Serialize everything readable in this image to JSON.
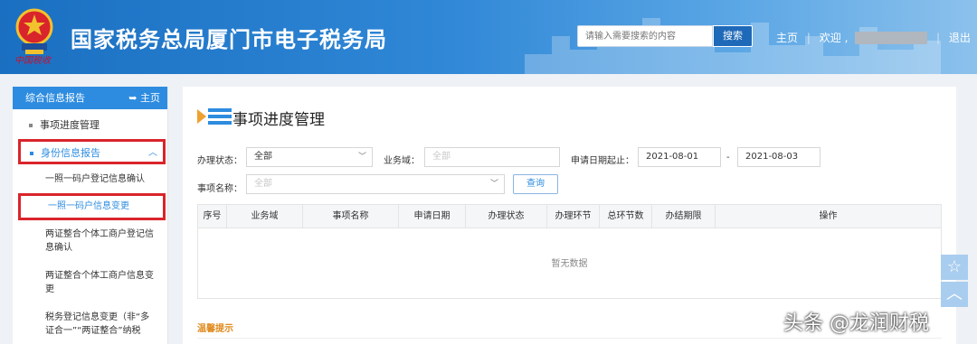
{
  "header": {
    "title": "国家税务总局厦门市电子税务局",
    "emblem_signature": "中国税收",
    "search_placeholder": "请输入需要搜索的内容",
    "search_button": "搜索",
    "home_link": "主页",
    "welcome": "欢迎",
    "logout": "退出",
    "separator": "|"
  },
  "sidebar": {
    "header": "综合信息报告",
    "home": "主页",
    "home_icon": "back-arrow-icon",
    "items": [
      {
        "label": "事项进度管理"
      },
      {
        "label": "身份信息报告"
      }
    ],
    "sub_items": [
      {
        "label": "一照一码户登记信息确认"
      },
      {
        "label": "一照一码户信息变更"
      },
      {
        "label": "两证整合个体工商户登记信息确认"
      },
      {
        "label": "两证整合个体工商户信息变更"
      },
      {
        "label": "税务登记信息变更（非“多证合一”“两证整合”纳税"
      }
    ]
  },
  "main": {
    "title": "事项进度管理",
    "filters": {
      "status_label": "办理状态：",
      "status_value": "全部",
      "domain_label": "业务域：",
      "domain_value": "全部",
      "date_label": "申请日期起止：",
      "date_from": "2021-08-01",
      "date_sep": "-",
      "date_to": "2021-08-03",
      "item_label": "事项名称：",
      "item_value": "全部",
      "query_button": "查询"
    },
    "table": {
      "columns": [
        "序号",
        "业务域",
        "事项名称",
        "申请日期",
        "办理状态",
        "办理环节",
        "总环节数",
        "办结期限",
        "操作"
      ],
      "empty_text": "暂无数据"
    },
    "tip": "温馨提示"
  },
  "float": {
    "star_icon": "star-icon",
    "up_icon": "chevron-up-icon"
  },
  "watermark": "头条 @龙润财税",
  "colors": {
    "header_blue": "#1a6fc1",
    "accent": "#2d8ce0",
    "highlight_red": "#d9242b",
    "tip_orange": "#e08a1e"
  }
}
